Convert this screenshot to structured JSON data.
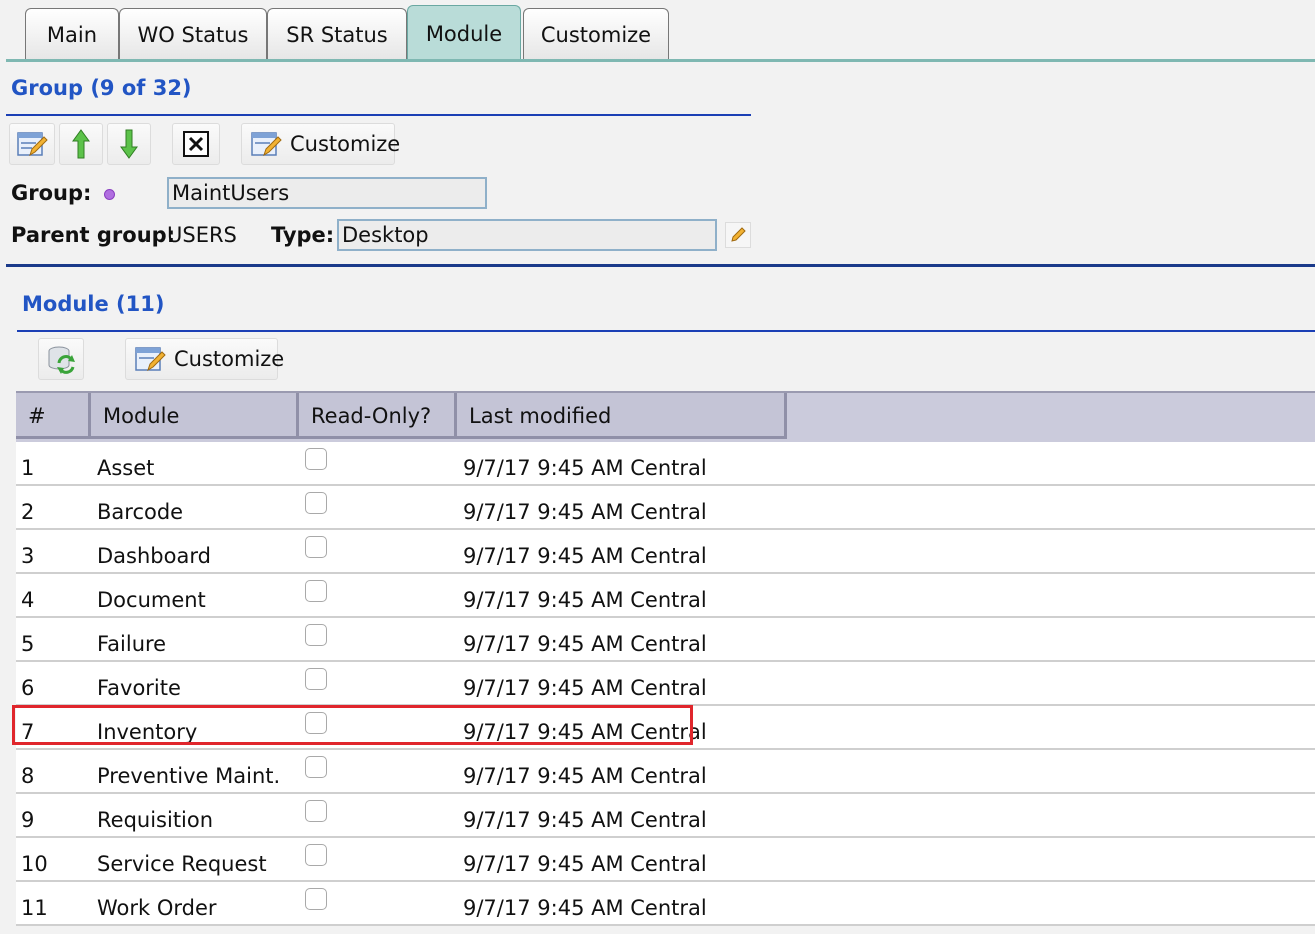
{
  "tabs": [
    {
      "label": "Main",
      "active": false
    },
    {
      "label": "WO Status",
      "active": false
    },
    {
      "label": "SR Status",
      "active": false
    },
    {
      "label": "Module",
      "active": true
    },
    {
      "label": "Customize",
      "active": false
    }
  ],
  "group_section": {
    "title": "Group (9 of 32)",
    "toolbar": {
      "edit_icon": "edit-record-icon",
      "up_icon": "move-up-arrow-icon",
      "down_icon": "move-down-arrow-icon",
      "delete_icon": "delete-x-icon",
      "customize_label": "Customize"
    },
    "group_label": "Group:",
    "group_value": "MaintUsers",
    "parent_label": "Parent group:",
    "parent_value": "USERS",
    "type_label": "Type:",
    "type_value": "Desktop"
  },
  "module_section": {
    "title": "Module (11)",
    "toolbar": {
      "refresh_icon": "refresh-icon",
      "customize_label": "Customize"
    },
    "columns": [
      "#",
      "Module",
      "Read-Only?",
      "Last modified"
    ],
    "rows": [
      {
        "num": "1",
        "module": "Asset",
        "read_only": false,
        "modified": "9/7/17 9:45 AM Central"
      },
      {
        "num": "2",
        "module": "Barcode",
        "read_only": false,
        "modified": "9/7/17 9:45 AM Central"
      },
      {
        "num": "3",
        "module": "Dashboard",
        "read_only": false,
        "modified": "9/7/17 9:45 AM Central"
      },
      {
        "num": "4",
        "module": "Document",
        "read_only": false,
        "modified": "9/7/17 9:45 AM Central"
      },
      {
        "num": "5",
        "module": "Failure",
        "read_only": false,
        "modified": "9/7/17 9:45 AM Central"
      },
      {
        "num": "6",
        "module": "Favorite",
        "read_only": false,
        "modified": "9/7/17 9:45 AM Central"
      },
      {
        "num": "7",
        "module": "Inventory",
        "read_only": false,
        "modified": "9/7/17 9:45 AM Central"
      },
      {
        "num": "8",
        "module": "Preventive Maint.",
        "read_only": false,
        "modified": "9/7/17 9:45 AM Central"
      },
      {
        "num": "9",
        "module": "Requisition",
        "read_only": false,
        "modified": "9/7/17 9:45 AM Central"
      },
      {
        "num": "10",
        "module": "Service Request",
        "read_only": false,
        "modified": "9/7/17 9:45 AM Central"
      },
      {
        "num": "11",
        "module": "Work Order",
        "read_only": false,
        "modified": "9/7/17 9:45 AM Central"
      }
    ],
    "highlighted_row": "7"
  },
  "colors": {
    "accent_blue": "#2255c4",
    "active_tab": "#b9dcd8",
    "highlight_red": "#e0262c"
  }
}
